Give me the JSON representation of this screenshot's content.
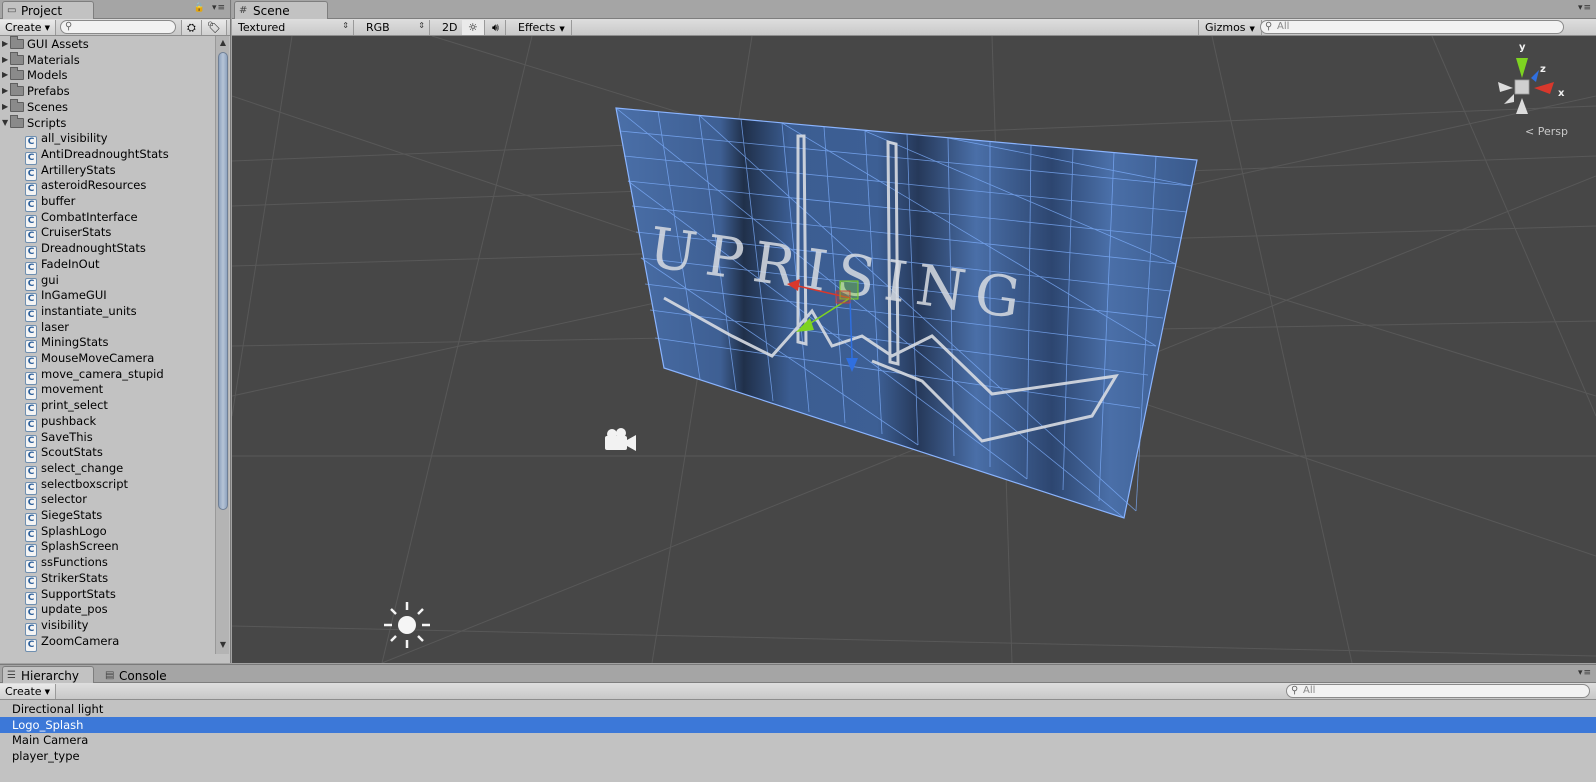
{
  "project": {
    "tab_label": "Project",
    "create_label": "Create",
    "search_placeholder": "",
    "folders": [
      {
        "label": "GUI Assets",
        "expanded": false
      },
      {
        "label": "Materials",
        "expanded": false
      },
      {
        "label": "Models",
        "expanded": false
      },
      {
        "label": "Prefabs",
        "expanded": false
      },
      {
        "label": "Scenes",
        "expanded": false
      },
      {
        "label": "Scripts",
        "expanded": true
      }
    ],
    "scripts": [
      "all_visibility",
      "AntiDreadnoughtStats",
      "ArtilleryStats",
      "asteroidResources",
      "buffer",
      "CombatInterface",
      "CruiserStats",
      "DreadnoughtStats",
      "FadeInOut",
      "gui",
      "InGameGUI",
      "instantiate_units",
      "laser",
      "MiningStats",
      "MouseMoveCamera",
      "move_camera_stupid",
      "movement",
      "print_select",
      "pushback",
      "SaveThis",
      "ScoutStats",
      "select_change",
      "selectboxscript",
      "selector",
      "SiegeStats",
      "SplashLogo",
      "SplashScreen",
      "ssFunctions",
      "StrikerStats",
      "SupportStats",
      "update_pos",
      "visibility",
      "ZoomCamera"
    ]
  },
  "scene": {
    "tab_label": "Scene",
    "shading_mode": "Textured",
    "render_mode": "RGB",
    "toggle_2d": "2D",
    "effects_label": "Effects",
    "gizmos_label": "Gizmos",
    "search_placeholder": "All",
    "persp_label": "Persp",
    "axis_labels": {
      "x": "x",
      "y": "y",
      "z": "z"
    },
    "logo_text": "UPRISING"
  },
  "hierarchy": {
    "tab_label": "Hierarchy",
    "console_tab_label": "Console",
    "create_label": "Create",
    "search_placeholder": "All",
    "items": [
      {
        "label": "Directional light",
        "selected": false
      },
      {
        "label": "Logo_Splash",
        "selected": true
      },
      {
        "label": "Main Camera",
        "selected": false
      },
      {
        "label": "player_type",
        "selected": false
      }
    ]
  },
  "colors": {
    "selection": "#3c78d8",
    "scene_background": "#474747",
    "panel_background": "#c2c2c2",
    "gizmo_x": "#d8382c",
    "gizmo_y": "#7ed321",
    "gizmo_z": "#2f6fe0"
  }
}
